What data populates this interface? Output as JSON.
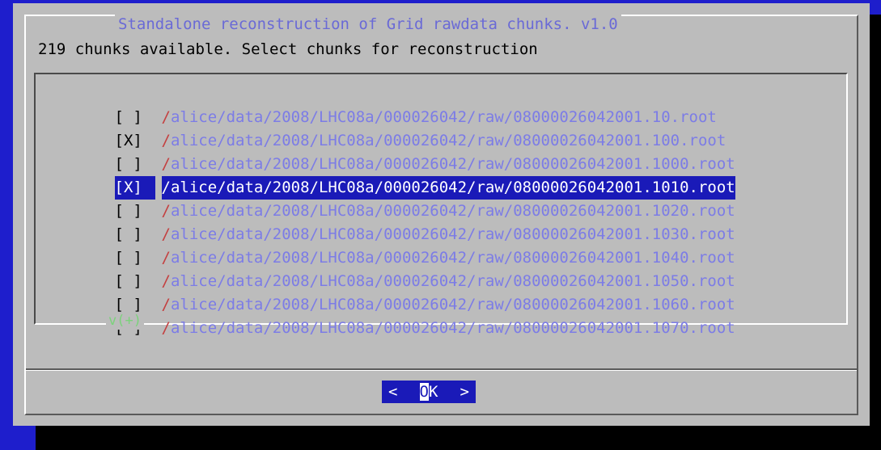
{
  "dialog": {
    "title": "Standalone reconstruction of Grid rawdata chunks. v1.0",
    "prompt": "219 chunks available. Select chunks for reconstruction"
  },
  "list": {
    "items": [
      {
        "check": "[ ]",
        "slash": "/",
        "path": "alice/data/2008/LHC08a/000026042/raw/08000026042001.10.root"
      },
      {
        "check": "[X]",
        "slash": "/",
        "path": "alice/data/2008/LHC08a/000026042/raw/08000026042001.100.root"
      },
      {
        "check": "[ ]",
        "slash": "/",
        "path": "alice/data/2008/LHC08a/000026042/raw/08000026042001.1000.root"
      },
      {
        "check": "[X]",
        "slash": "/",
        "path": "alice/data/2008/LHC08a/000026042/raw/08000026042001.1010.root"
      },
      {
        "check": "[ ]",
        "slash": "/",
        "path": "alice/data/2008/LHC08a/000026042/raw/08000026042001.1020.root"
      },
      {
        "check": "[ ]",
        "slash": "/",
        "path": "alice/data/2008/LHC08a/000026042/raw/08000026042001.1030.root"
      },
      {
        "check": "[ ]",
        "slash": "/",
        "path": "alice/data/2008/LHC08a/000026042/raw/08000026042001.1040.root"
      },
      {
        "check": "[ ]",
        "slash": "/",
        "path": "alice/data/2008/LHC08a/000026042/raw/08000026042001.1050.root"
      },
      {
        "check": "[ ]",
        "slash": "/",
        "path": "alice/data/2008/LHC08a/000026042/raw/08000026042001.1060.root"
      },
      {
        "check": "[ ]",
        "slash": "/",
        "path": "alice/data/2008/LHC08a/000026042/raw/08000026042001.1070.root"
      }
    ],
    "selected_index": 3,
    "more_indicator": "v(+)"
  },
  "buttons": {
    "ok_left": "<",
    "ok_hot": "O",
    "ok_rest": "K",
    "ok_right": ">"
  },
  "colors": {
    "screen_bg": "#1e1ecc",
    "dialog_bg": "#bcbcbc",
    "path_text": "#7c7ce6",
    "slash_text": "#c44040",
    "highlight": "#1a1ab8"
  }
}
